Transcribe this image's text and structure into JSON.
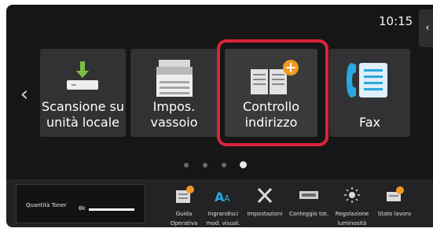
{
  "status": {
    "time": "10:15"
  },
  "tiles": [
    {
      "label": "Scansione su\nunità locale",
      "icon": "download-to-drive-icon"
    },
    {
      "label": "Impos. vassoio",
      "icon": "printer-icon"
    },
    {
      "label": "Controllo\nindirizzo",
      "icon": "address-book-add-icon"
    },
    {
      "label": "Fax",
      "icon": "fax-phone-icon"
    }
  ],
  "highlight_color": "#d9253a",
  "pager": {
    "pages": 4,
    "current": 4
  },
  "toner": {
    "label": "Quantità Toner",
    "bk_label": "Bk"
  },
  "shortcuts": [
    {
      "label": "Guida\nOperativa",
      "icon": "guide-book-icon"
    },
    {
      "label": "Ingrandisci\nmod. visual.",
      "icon": "text-enlarge-icon"
    },
    {
      "label": "Impostazioni",
      "icon": "wrench-screwdriver-icon"
    },
    {
      "label": "Conteggio tot.",
      "icon": "counter-icon"
    },
    {
      "label": "Regolazione\nluminosità",
      "icon": "brightness-icon"
    },
    {
      "label": "Stato lavoro",
      "icon": "job-status-icon"
    }
  ]
}
